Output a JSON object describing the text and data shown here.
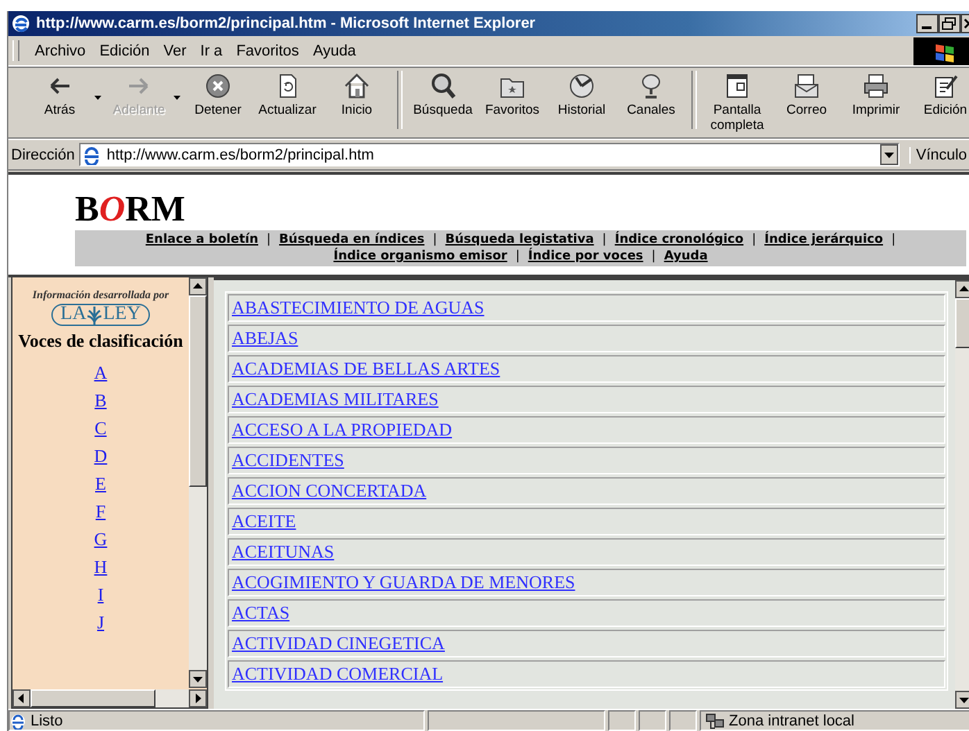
{
  "window": {
    "title": "http://www.carm.es/borm2/principal.htm - Microsoft Internet Explorer"
  },
  "menu": [
    "Archivo",
    "Edición",
    "Ver",
    "Ir a",
    "Favoritos",
    "Ayuda"
  ],
  "toolbar": {
    "groups": [
      [
        {
          "label": "Atrás",
          "disabled": false,
          "dropdown": true
        },
        {
          "label": "Adelante",
          "disabled": true,
          "dropdown": true
        },
        {
          "label": "Detener",
          "disabled": false,
          "dropdown": false
        },
        {
          "label": "Actualizar",
          "disabled": false,
          "dropdown": false
        },
        {
          "label": "Inicio",
          "disabled": false,
          "dropdown": false
        }
      ],
      [
        {
          "label": "Búsqueda",
          "disabled": false,
          "dropdown": false
        },
        {
          "label": "Favoritos",
          "disabled": false,
          "dropdown": false
        },
        {
          "label": "Historial",
          "disabled": false,
          "dropdown": false
        },
        {
          "label": "Canales",
          "disabled": false,
          "dropdown": false
        }
      ],
      [
        {
          "label": "Pantalla completa",
          "disabled": false,
          "dropdown": false
        },
        {
          "label": "Correo",
          "disabled": false,
          "dropdown": false
        },
        {
          "label": "Imprimir",
          "disabled": false,
          "dropdown": false
        },
        {
          "label": "Edición",
          "disabled": false,
          "dropdown": false
        }
      ]
    ]
  },
  "address": {
    "label": "Dirección",
    "value": "http://www.carm.es/borm2/principal.htm",
    "links_label": "Vínculo"
  },
  "header": {
    "logo": "BORM",
    "nav_rows": [
      [
        {
          "kind": "link",
          "text": "Enlace a boletín"
        },
        {
          "kind": "separator",
          "text": "|"
        },
        {
          "kind": "link",
          "text": "Búsqueda en índices"
        },
        {
          "kind": "separator",
          "text": "|"
        },
        {
          "kind": "link",
          "text": "Búsqueda legistativa"
        },
        {
          "kind": "separator",
          "text": "|"
        },
        {
          "kind": "link",
          "text": "Índice cronológico"
        },
        {
          "kind": "separator",
          "text": "|"
        },
        {
          "kind": "link",
          "text": "Índice jerárquico"
        },
        {
          "kind": "separator",
          "text": "|"
        }
      ],
      [
        {
          "kind": "link",
          "text": "Índice organismo emisor"
        },
        {
          "kind": "separator",
          "text": "|"
        },
        {
          "kind": "link",
          "text": "Índice por voces"
        },
        {
          "kind": "separator",
          "text": "|"
        },
        {
          "kind": "link",
          "text": "Ayuda"
        }
      ]
    ]
  },
  "sidebar": {
    "credit": "Información desarrollada por",
    "logo_left": "LA",
    "logo_right": "LEY",
    "heading": "Voces de clasificación",
    "letters": [
      "A",
      "B",
      "C",
      "D",
      "E",
      "F",
      "G",
      "H",
      "I",
      "J"
    ]
  },
  "list": {
    "items": [
      "ABASTECIMIENTO DE AGUAS",
      "ABEJAS",
      "ACADEMIAS DE BELLAS ARTES",
      "ACADEMIAS MILITARES",
      "ACCESO A LA PROPIEDAD",
      "ACCIDENTES",
      "ACCION CONCERTADA",
      "ACEITE",
      "ACEITUNAS",
      "ACOGIMIENTO Y GUARDA DE MENORES",
      "ACTAS",
      "ACTIVIDAD CINEGETICA",
      "ACTIVIDAD COMERCIAL"
    ]
  },
  "status_bar": {
    "text": "Listo",
    "zone": "Zona intranet local"
  }
}
